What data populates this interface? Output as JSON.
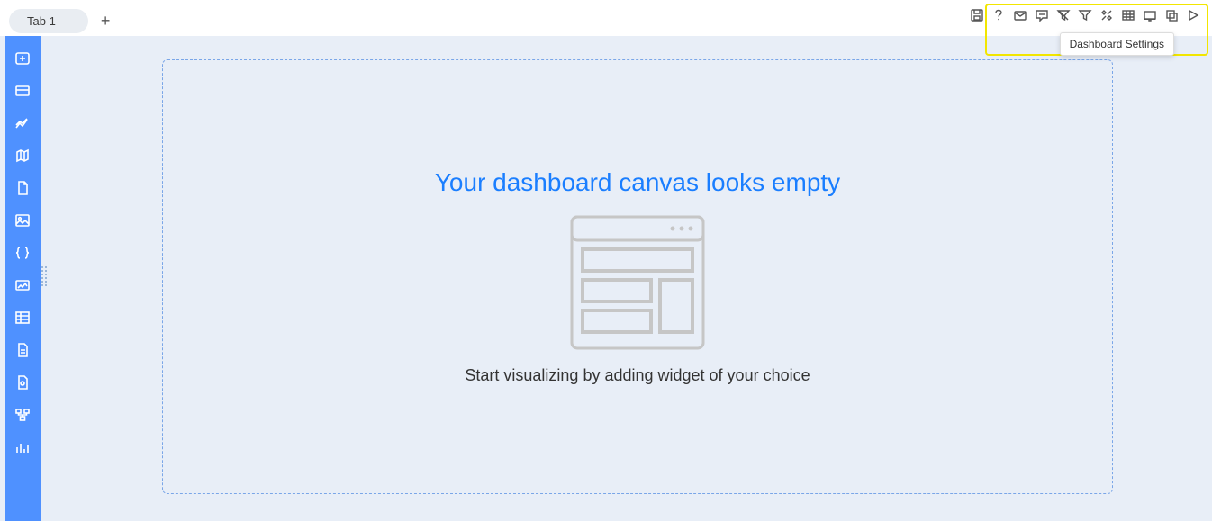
{
  "tabs": [
    {
      "label": "Tab 1"
    }
  ],
  "tooltip": {
    "text": "Dashboard Settings"
  },
  "canvas": {
    "empty_title": "Your dashboard canvas looks empty",
    "empty_subtitle": "Start visualizing by adding widget of your choice"
  },
  "toolbar": {
    "icons": [
      "save-icon",
      "help-icon",
      "mail-icon",
      "comment-icon",
      "clear-filter-icon",
      "filter-icon",
      "settings-icon",
      "table-icon",
      "layout-icon",
      "clone-icon",
      "play-icon"
    ]
  },
  "sidebar": {
    "icons": [
      "insert-icon",
      "card-icon",
      "line-chart-icon",
      "map-icon",
      "document-icon",
      "image-icon",
      "braces-icon",
      "gallery-icon",
      "grid-icon",
      "page-icon",
      "file-icon",
      "tree-icon",
      "bar-chart-icon"
    ]
  }
}
